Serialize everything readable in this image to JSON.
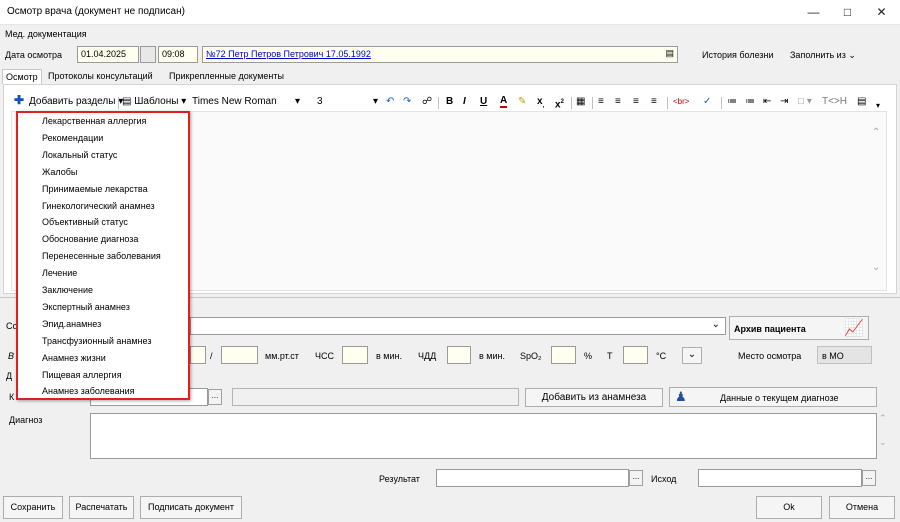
{
  "window": {
    "title": "Осмотр врача (документ не подписан)",
    "minimize_icon": "minimize-icon",
    "maximize_icon": "maximize-icon",
    "close_icon": "close-icon"
  },
  "menu": {
    "med_docs": "Мед. документация"
  },
  "header": {
    "date_label": "Дата осмотра",
    "date_value": "01.04.2025",
    "time_value": "09:08",
    "patient_link": "№72 Петр Петров Петрович 17.05.1992",
    "history_label": "История болезни",
    "fill_from_label": "Заполнить из"
  },
  "tabs": [
    "Осмотр",
    "Протоколы консультаций",
    "Прикрепленные документы"
  ],
  "toolbar": {
    "add_sections": "Добавить разделы",
    "templates": "Шаблоны",
    "font_name": "Times New Roman",
    "font_size": "3",
    "html_toggle": "T<>H"
  },
  "dropdown_items": [
    "Лекарственная аллергия",
    "Рекомендации",
    "Локальный статус",
    "Жалобы",
    "Принимаемые лекарства",
    "Гинекологический анамнез",
    "Объективный статус",
    "Обоснование диагноза",
    "Перенесенные заболевания",
    "Лечение",
    "Заключение",
    "Экспертный анамнез",
    "Эпид.анамнез",
    "Трансфузионный анамнез",
    "Анамнез жизни",
    "Пищевая аллергия",
    "Анамнез заболевания"
  ],
  "vitals": {
    "slash": "/",
    "pressure_unit": "мм.рт.ст",
    "hr_label": "ЧСС",
    "hr_unit": "в мин.",
    "rr_label": "ЧДД",
    "rr_unit": "в мин.",
    "spo2_label": "SpO₂",
    "spo2_unit": "%",
    "temp_label": "Т",
    "temp_unit": "°C"
  },
  "patient_archive": "Архив пациента",
  "exam_place_label": "Место осмотра",
  "exam_place_value": "в МО",
  "diagnosis": {
    "add_from_anamnesis": "Добавить из анамнеза",
    "current_diagnosis_data": "Данные о текущем диагнозе",
    "label": "Диагноз"
  },
  "cut_labels": {
    "co": "Со",
    "v": "В",
    "d": "Д",
    "k": "К"
  },
  "result_label": "Результат",
  "outcome_label": "Исход",
  "footer": {
    "save": "Сохранить",
    "print": "Распечатать",
    "sign": "Подписать документ",
    "ok": "Ok",
    "cancel": "Отмена"
  }
}
